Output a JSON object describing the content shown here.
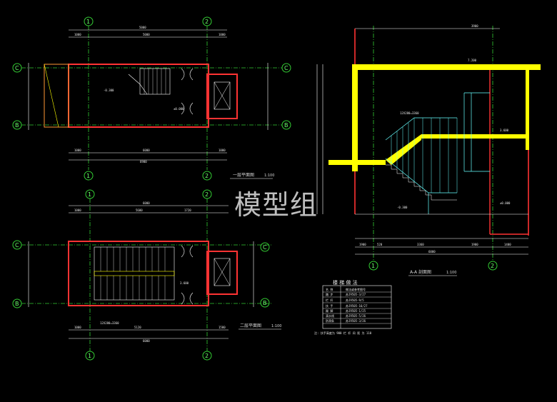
{
  "watermark": "模型组",
  "colors": {
    "background": "#000000",
    "grid": "#33cc33",
    "wall": "#ff3333",
    "dimension": "#ffffff",
    "stair": "#66ffff",
    "highlight": "#ffff00",
    "orange": "#ff9933"
  },
  "plan1": {
    "title": "一层平面图",
    "scale": "1:100",
    "axis": [
      "1",
      "2",
      "C",
      "B"
    ],
    "dims_top": [
      "1000",
      "5000",
      "1000"
    ],
    "dims_top_total": "5000",
    "dims_bottom": [
      "1000",
      "6000",
      "1000"
    ],
    "dims_bottom_total": "6900",
    "level": "-0.300",
    "elev_tag": "±0.000"
  },
  "plan2": {
    "title": "二层平面图",
    "scale": "1:100",
    "axis": [
      "1",
      "2",
      "C",
      "B"
    ],
    "dims_top": [
      "1000",
      "5600",
      "1720"
    ],
    "dims_top_total": "6000",
    "dims_bottom": [
      "1000",
      "5120",
      "1580"
    ],
    "dims_bottom_total": "6000",
    "stair_note": "12X280=3360",
    "level": "3.600"
  },
  "section": {
    "title": "A-A 剖面图",
    "scale": "1:100",
    "axis": [
      "1",
      "2"
    ],
    "top_dim": "3900",
    "levels": [
      "7.200",
      "3.600",
      "±0.000",
      "-0.300"
    ],
    "stair_note": "12X280=3360",
    "dims_bottom": [
      "1900",
      "520",
      "3360",
      "1900",
      "1400"
    ],
    "dims_bottom_total": "6000"
  },
  "table": {
    "title": "楼 梯 做 法",
    "header": [
      "名 称",
      "做法或参考图号"
    ],
    "rows": [
      [
        "踏 步",
        "苏J9505-3/27"
      ],
      [
        "栏 杆",
        "苏J9505-9/5"
      ],
      [
        "扶 手",
        "苏J9505-16/27"
      ],
      [
        "踢 脚",
        "苏J9505-1/25"
      ],
      [
        "滴水线",
        "苏J9505-5/26"
      ],
      [
        "防滑条",
        "苏J9505-3/26"
      ]
    ],
    "footnote": "注: 扶手高度为 900 栏 杆 间 距 为 110"
  }
}
